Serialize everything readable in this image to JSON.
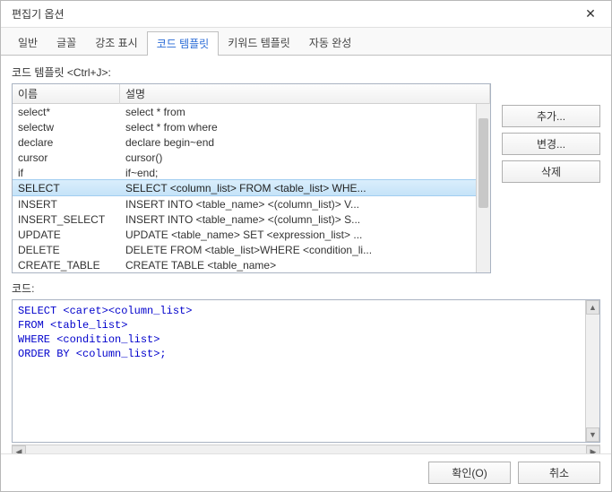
{
  "dialog": {
    "title": "편집기 옵션"
  },
  "tabs": [
    {
      "label": "일반",
      "active": false
    },
    {
      "label": "글꼴",
      "active": false
    },
    {
      "label": "강조 표시",
      "active": false
    },
    {
      "label": "코드 템플릿",
      "active": true
    },
    {
      "label": "키워드 템플릿",
      "active": false
    },
    {
      "label": "자동 완성",
      "active": false
    }
  ],
  "templates_label": "코드 템플릿 <Ctrl+J>:",
  "columns": {
    "name": "이름",
    "desc": "설명"
  },
  "rows": [
    {
      "name": "select*",
      "desc": "select * from",
      "selected": false
    },
    {
      "name": "selectw",
      "desc": "select * from where",
      "selected": false
    },
    {
      "name": "declare",
      "desc": "declare begin~end",
      "selected": false
    },
    {
      "name": "cursor",
      "desc": "cursor()",
      "selected": false
    },
    {
      "name": "if",
      "desc": "if~end;",
      "selected": false
    },
    {
      "name": "SELECT",
      "desc": "SELECT <column_list> FROM <table_list> WHE...",
      "selected": true
    },
    {
      "name": "INSERT",
      "desc": "INSERT INTO <table_name> <(column_list)> V...",
      "selected": false
    },
    {
      "name": "INSERT_SELECT",
      "desc": "INSERT INTO <table_name> <(column_list)> S...",
      "selected": false
    },
    {
      "name": "UPDATE",
      "desc": "UPDATE <table_name> SET <expression_list> ...",
      "selected": false
    },
    {
      "name": "DELETE",
      "desc": "DELETE FROM <table_list>WHERE <condition_li...",
      "selected": false
    },
    {
      "name": "CREATE_TABLE",
      "desc": "CREATE TABLE <table_name>",
      "selected": false
    }
  ],
  "side_buttons": {
    "add": "추가...",
    "edit": "변경...",
    "delete": "삭제"
  },
  "code_label": "코드:",
  "code_lines": [
    "SELECT <caret><column_list>",
    "FROM <table_list>",
    "WHERE <condition_list>",
    "ORDER BY <column_list>;"
  ],
  "footer": {
    "ok": "확인(O)",
    "cancel": "취소"
  }
}
